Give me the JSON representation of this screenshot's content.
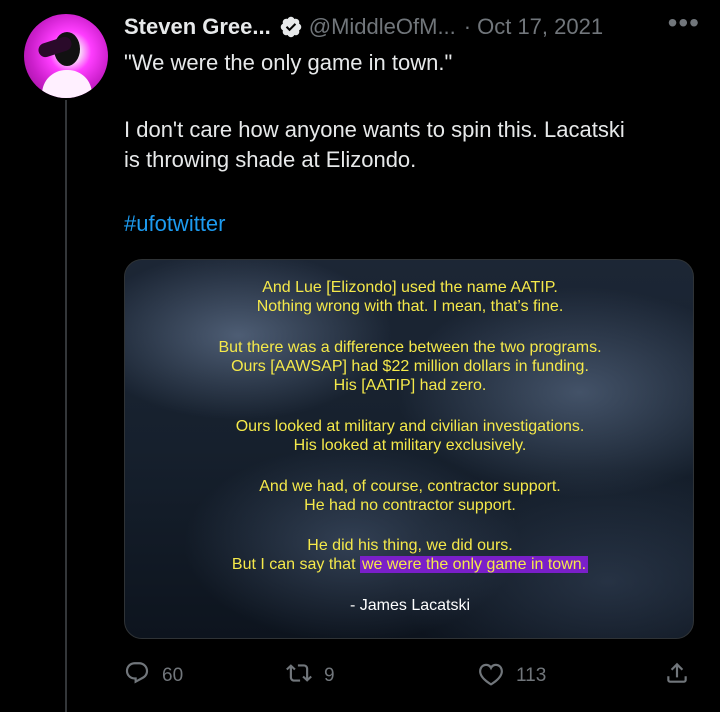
{
  "tweet": {
    "author": {
      "display_name": "Steven Gree...",
      "handle": "@MiddleOfM...",
      "verified_icon": "verified-badge-icon"
    },
    "separator": "·",
    "date": "Oct 17, 2021",
    "more_icon": "more-options-icon",
    "more_label": "•••",
    "text": {
      "line1": "\"We were the only game in town.\"",
      "line2": "I don't care how anyone wants to spin this. Lacatski",
      "line3": "is throwing shade at Elizondo.",
      "hashtag": "#ufotwitter"
    },
    "media": {
      "paragraphs": [
        [
          "And Lue [Elizondo] used the name AATIP.",
          "Nothing wrong with that. I mean, that’s fine."
        ],
        [
          "But there was a difference between the two programs.",
          "Ours [AAWSAP] had $22 million dollars in funding.",
          "His [AATIP] had zero."
        ],
        [
          "Ours looked at military and civilian investigations.",
          "His looked at military exclusively."
        ],
        [
          "And we had, of course, contractor support.",
          "He had no contractor support."
        ],
        [
          "He did his thing, we did ours."
        ]
      ],
      "final_line_prefix": "But I can say that ",
      "final_line_highlight": "we were the only game in town.",
      "attribution": "- James Lacatski",
      "text_color": "#f5e94a",
      "highlight_color": "#7a1fc9"
    },
    "actions": {
      "reply": {
        "icon": "reply-icon",
        "count": "60"
      },
      "retweet": {
        "icon": "retweet-icon",
        "count": "9"
      },
      "like": {
        "icon": "like-icon",
        "count": "113"
      },
      "share": {
        "icon": "share-icon"
      }
    }
  },
  "colors": {
    "background": "#000000",
    "text": "#e7e9ea",
    "secondary": "#71767b",
    "link": "#1d9bf0",
    "verified": "#1d9bf0"
  }
}
